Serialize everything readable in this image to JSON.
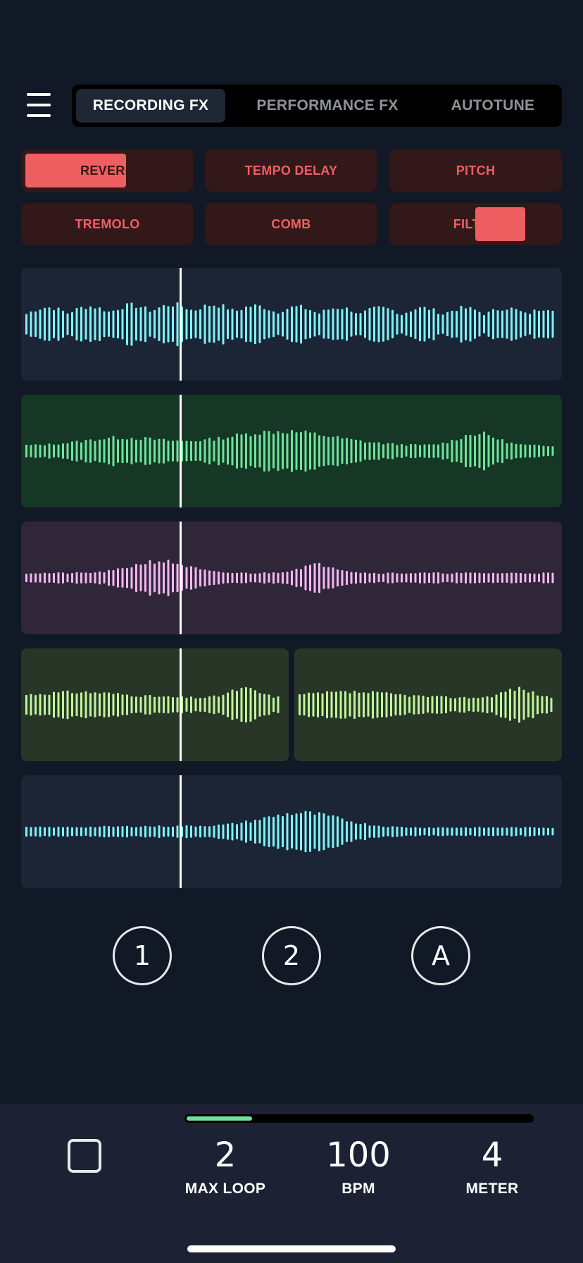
{
  "tabs": [
    {
      "label": "RECORDING FX",
      "active": true
    },
    {
      "label": "PERFORMANCE FX",
      "active": false
    },
    {
      "label": "AUTOTUNE",
      "active": false
    }
  ],
  "effects": [
    {
      "label": "REVERB",
      "level": 0.6
    },
    {
      "label": "TEMPO DELAY",
      "level": 0
    },
    {
      "label": "PITCH",
      "level": 0
    },
    {
      "label": "TREMOLO",
      "level": 0
    },
    {
      "label": "COMB",
      "level": 0
    },
    {
      "label": "FILTER",
      "level": 0.3
    }
  ],
  "tracks": [
    {
      "color": "#7ef3f7",
      "bg": "#1b2536"
    },
    {
      "color": "#6ee39a",
      "bg": "#163626"
    },
    {
      "color": "#f3b7f2",
      "bg": "#30263a"
    },
    {
      "color": "#c0f59c",
      "bg": "#283627"
    },
    {
      "color": "#7ef3f7",
      "bg": "#1b2536"
    }
  ],
  "loop_buttons": [
    "1",
    "2",
    "A"
  ],
  "bottom_bar": {
    "max_loop_value": "2",
    "max_loop_label": "MAX LOOP",
    "bpm_value": "100",
    "bpm_label": "BPM",
    "meter_value": "4",
    "meter_label": "METER",
    "progress": 0.19
  },
  "colors": {
    "fx_accent": "#ef5f62",
    "fx_bg": "#321819",
    "background": "#111826"
  }
}
